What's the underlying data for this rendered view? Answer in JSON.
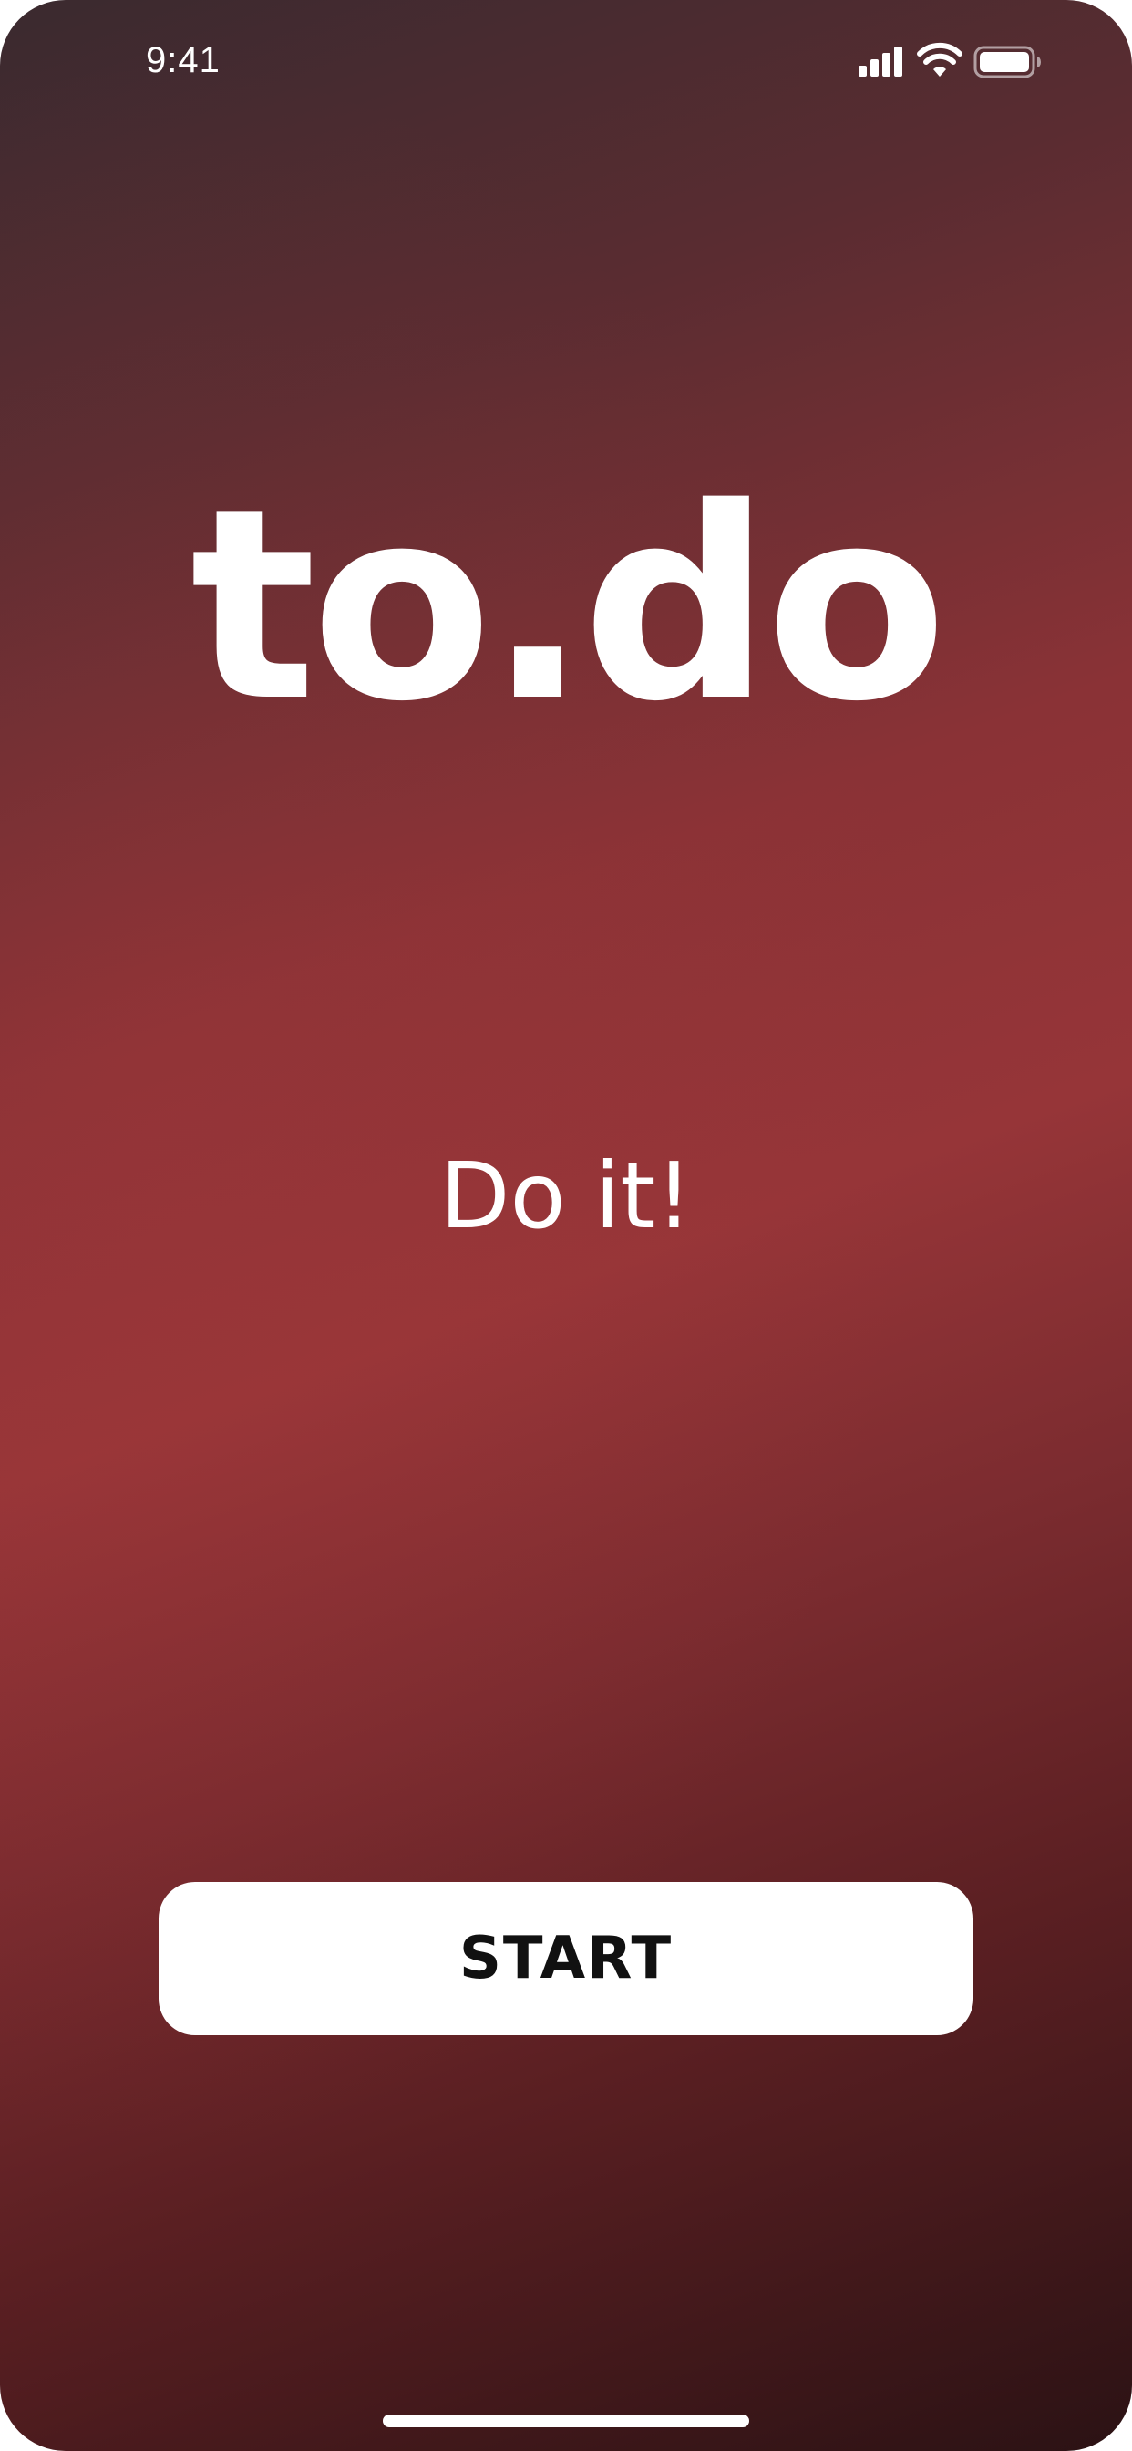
{
  "status_bar": {
    "time": "9:41",
    "icons": [
      "signal-icon",
      "wifi-icon",
      "battery-icon"
    ]
  },
  "app": {
    "title": "to.do",
    "tagline": "Do it!"
  },
  "actions": {
    "start_label": "START"
  },
  "colors": {
    "background_top": "#3a2a2f",
    "background_mid": "#963538",
    "background_bottom": "#2b1214",
    "button_bg": "#ffffff",
    "button_text": "#111111",
    "text": "#ffffff"
  }
}
